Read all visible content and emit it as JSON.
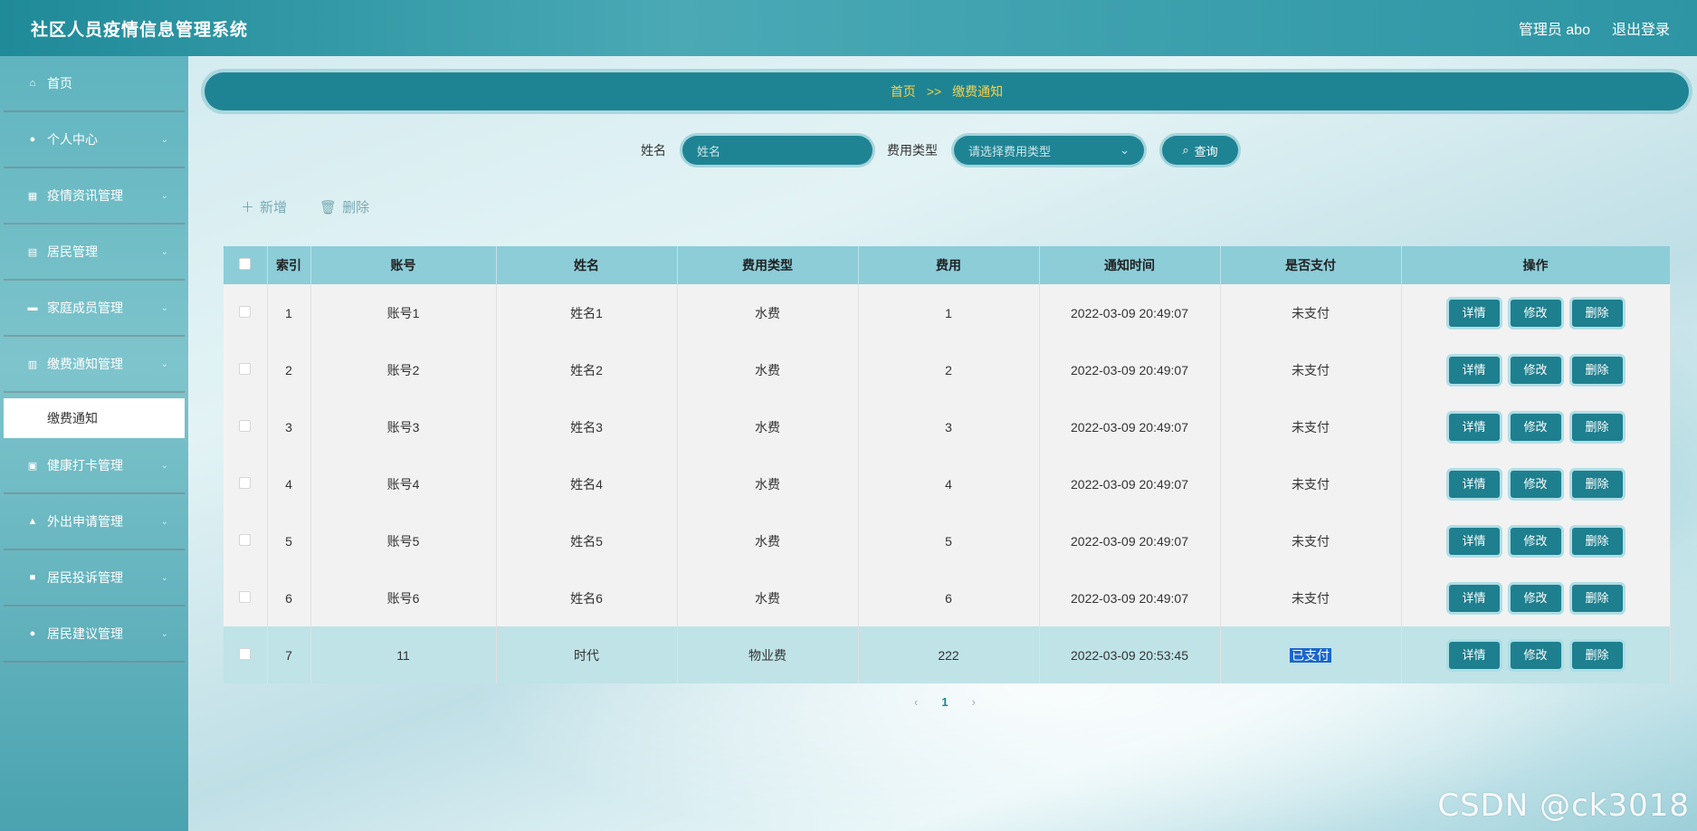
{
  "header": {
    "app_title": "社区人员疫情信息管理系统",
    "admin_label": "管理员 abo",
    "logout_label": "退出登录"
  },
  "sidebar": {
    "items": [
      {
        "label": "首页",
        "icon": "home-icon"
      },
      {
        "label": "个人中心",
        "icon": "user-icon"
      },
      {
        "label": "疫情资讯管理",
        "icon": "grid-icon"
      },
      {
        "label": "居民管理",
        "icon": "list-icon"
      },
      {
        "label": "家庭成员管理",
        "icon": "monitor-icon"
      },
      {
        "label": "缴费通知管理",
        "icon": "chart-icon"
      },
      {
        "label": "健康打卡管理",
        "icon": "printer-icon"
      },
      {
        "label": "外出申请管理",
        "icon": "trend-icon"
      },
      {
        "label": "居民投诉管理",
        "icon": "briefcase-icon"
      },
      {
        "label": "居民建议管理",
        "icon": "bulb-icon"
      }
    ],
    "active_sub": "缴费通知"
  },
  "breadcrumb": {
    "home": "首页",
    "sep": ">>",
    "current": "缴费通知"
  },
  "search": {
    "name_label": "姓名",
    "name_placeholder": "姓名",
    "type_label": "费用类型",
    "type_placeholder": "请选择费用类型",
    "query_label": "查询"
  },
  "actions": {
    "add_label": "新增",
    "delete_label": "删除"
  },
  "table": {
    "headers": [
      "索引",
      "账号",
      "姓名",
      "费用类型",
      "费用",
      "通知时间",
      "是否支付",
      "操作"
    ],
    "rows": [
      {
        "index": "1",
        "account": "账号1",
        "name": "姓名1",
        "type": "水费",
        "fee": "1",
        "time": "2022-03-09 20:49:07",
        "paid": "未支付"
      },
      {
        "index": "2",
        "account": "账号2",
        "name": "姓名2",
        "type": "水费",
        "fee": "2",
        "time": "2022-03-09 20:49:07",
        "paid": "未支付"
      },
      {
        "index": "3",
        "account": "账号3",
        "name": "姓名3",
        "type": "水费",
        "fee": "3",
        "time": "2022-03-09 20:49:07",
        "paid": "未支付"
      },
      {
        "index": "4",
        "account": "账号4",
        "name": "姓名4",
        "type": "水费",
        "fee": "4",
        "time": "2022-03-09 20:49:07",
        "paid": "未支付"
      },
      {
        "index": "5",
        "account": "账号5",
        "name": "姓名5",
        "type": "水费",
        "fee": "5",
        "time": "2022-03-09 20:49:07",
        "paid": "未支付"
      },
      {
        "index": "6",
        "account": "账号6",
        "name": "姓名6",
        "type": "水费",
        "fee": "6",
        "time": "2022-03-09 20:49:07",
        "paid": "未支付"
      },
      {
        "index": "7",
        "account": "11",
        "name": "时代",
        "type": "物业费",
        "fee": "222",
        "time": "2022-03-09 20:53:45",
        "paid": "已支付"
      }
    ],
    "op_labels": {
      "detail": "详情",
      "edit": "修改",
      "delete": "删除"
    }
  },
  "pagination": {
    "prev": "‹",
    "current": "1",
    "next": "›"
  },
  "watermark": "CSDN @ck3018",
  "colors": {
    "primary": "#1e8494",
    "breadcrumb_text": "#f5d14a",
    "table_header": "#8ccdd8"
  }
}
